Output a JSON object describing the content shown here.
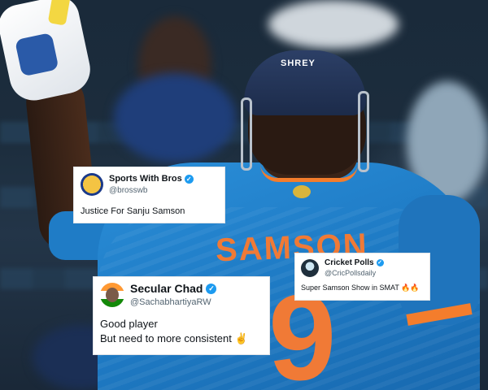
{
  "photo": {
    "helmet_brand": "SHREY",
    "jersey_name": "SAMSON",
    "jersey_number": "9"
  },
  "tweets": [
    {
      "name": "Sports With Bros",
      "handle": "@brosswb",
      "text": "Justice For Sanju Samson",
      "verified_icon": "verified-badge-icon",
      "avatar_icon": "sports-with-bros-logo-avatar"
    },
    {
      "name": "Secular Chad",
      "handle": "@SachabhartiyaRW",
      "text_line1": "Good player",
      "text_line2": "But need to more consistent ✌️",
      "verified_icon": "verified-badge-icon",
      "avatar_icon": "secular-chad-avatar"
    },
    {
      "name": "Cricket Polls",
      "handle": "@CricPollsdaily",
      "text": "Super Samson Show in SMAT 🔥🔥",
      "verified_icon": "verified-badge-icon",
      "avatar_icon": "cricket-polls-avatar"
    }
  ],
  "colors": {
    "jersey_blue": "#1f7cc6",
    "jersey_orange": "#f07a36",
    "verified_blue": "#1d9bf0"
  }
}
